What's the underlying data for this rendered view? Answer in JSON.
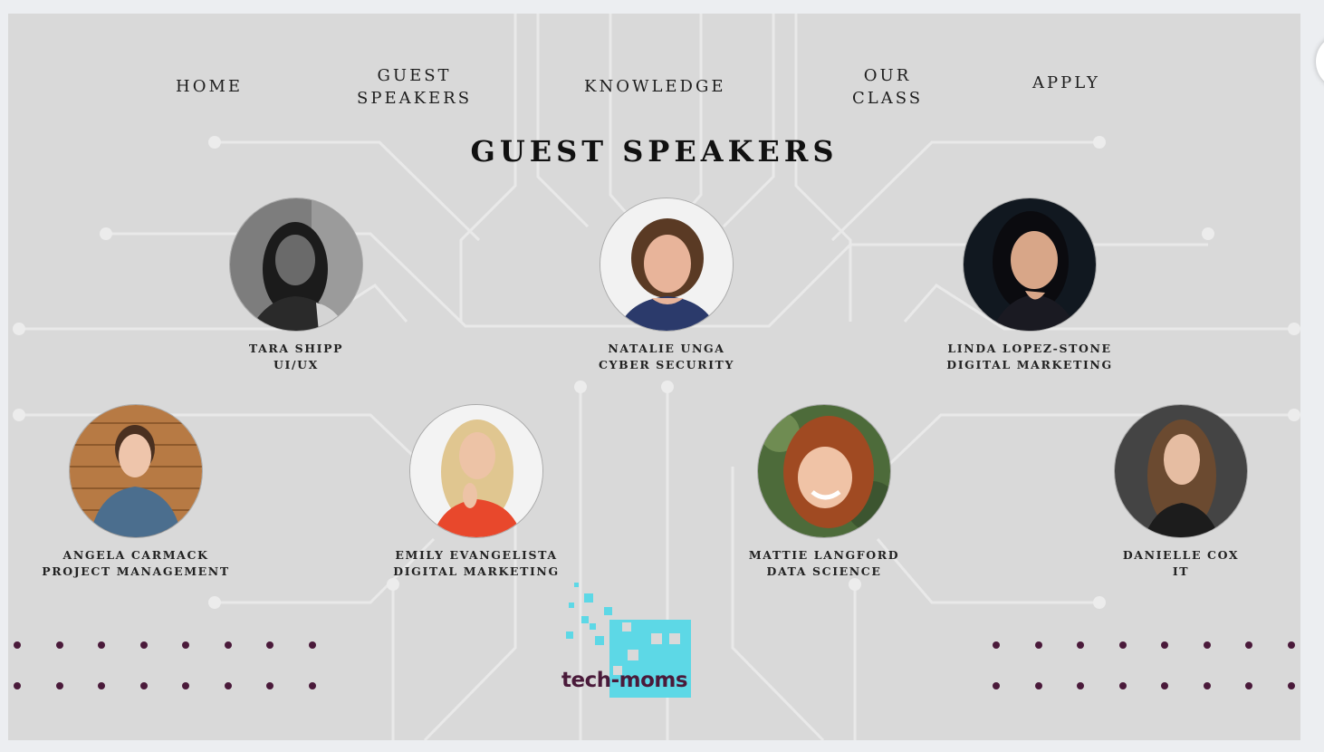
{
  "nav": {
    "home": "HOME",
    "guest_speakers": [
      "GUEST",
      "SPEAKERS"
    ],
    "knowledge": "KNOWLEDGE",
    "our_class": [
      "OUR",
      "CLASS"
    ],
    "apply": "APPLY"
  },
  "page_title": "GUEST SPEAKERS",
  "speakers": [
    {
      "name": "TARA SHIPP",
      "role": "UI/UX",
      "photo": "portrait-grayscale"
    },
    {
      "name": "NATALIE UNGA",
      "role": "CYBER SECURITY",
      "photo": "portrait-white-background"
    },
    {
      "name": "LINDA LOPEZ-STONE",
      "role": "DIGITAL MARKETING",
      "photo": "portrait-dark-background"
    },
    {
      "name": "ANGELA CARMACK",
      "role": "PROJECT MANAGEMENT",
      "photo": "portrait-wood-background"
    },
    {
      "name": "EMILY EVANGELISTA",
      "role": "DIGITAL MARKETING",
      "photo": "portrait-white-background"
    },
    {
      "name": "MATTIE LANGFORD",
      "role": "DATA SCIENCE",
      "photo": "portrait-green-background"
    },
    {
      "name": "DANIELLE COX",
      "role": "IT",
      "photo": "portrait-gray-background"
    }
  ],
  "logo": {
    "text": "tech-moms"
  },
  "colors": {
    "accent": "#4a1a3a",
    "logo_cyan": "#5dd8e6",
    "background": "#d9d9d9"
  }
}
